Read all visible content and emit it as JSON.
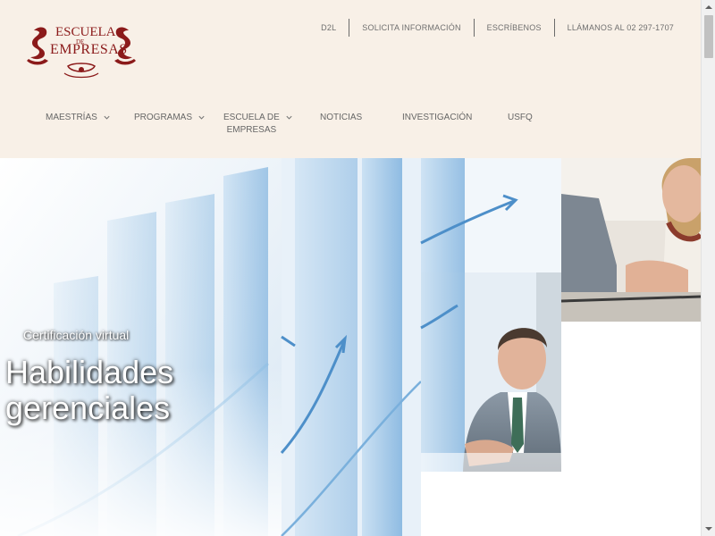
{
  "logo": {
    "line1": "ESCUELA",
    "line2": "DE",
    "line3": "EMPRESAS",
    "color": "#8b1a1a"
  },
  "topbar": {
    "links": [
      "D2L",
      "SOLICITA INFORMACIÓN",
      "ESCRÍBENOS",
      "LLÁMANOS AL 02 297-1707"
    ]
  },
  "nav": {
    "items": [
      {
        "label": "MAESTRÍAS",
        "has_dropdown": true
      },
      {
        "label": "PROGRAMAS",
        "has_dropdown": true
      },
      {
        "label": "ESCUELA DE\nEMPRESAS",
        "has_dropdown": true
      },
      {
        "label": "NOTICIAS",
        "has_dropdown": false
      },
      {
        "label": "INVESTIGACIÓN",
        "has_dropdown": false
      },
      {
        "label": "USFQ",
        "has_dropdown": false
      }
    ]
  },
  "hero": {
    "subtitle": "Certificación virtual",
    "title": "Habilidades\ngerenciales"
  },
  "colors": {
    "header_bg": "#f8f0e7",
    "nav_text": "#666666",
    "logo_red": "#8b1a1a"
  }
}
